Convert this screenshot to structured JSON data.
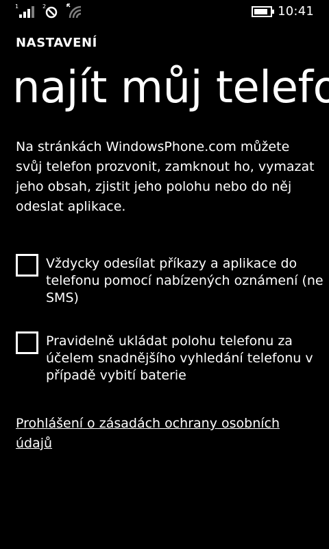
{
  "status_bar": {
    "signal_icon": "signal-strength-icon",
    "data_icon": "data-sync-icon",
    "wifi_icon": "wifi-icon",
    "battery_icon": "battery-icon",
    "time": "10:41"
  },
  "header": {
    "app_title": "NASTAVENÍ",
    "page_title": "najít můj telefon"
  },
  "main": {
    "description": "Na stránkách WindowsPhone.com můžete svůj telefon prozvonit, zamknout ho, vymazat jeho obsah, zjistit jeho polohu nebo do něj odeslat aplikace.",
    "options": [
      {
        "label": "Vždycky odesílat příkazy a aplikace do telefonu pomocí nabízených oznámení (ne SMS)",
        "checked": false
      },
      {
        "label": "Pravidelně ukládat polohu telefonu za účelem snadnějšího vyhledání telefonu v případě vybití baterie",
        "checked": false
      }
    ],
    "privacy_link": "Prohlášení o zásadách ochrany osobních údajů"
  },
  "colors": {
    "background": "#000000",
    "foreground": "#ffffff"
  }
}
